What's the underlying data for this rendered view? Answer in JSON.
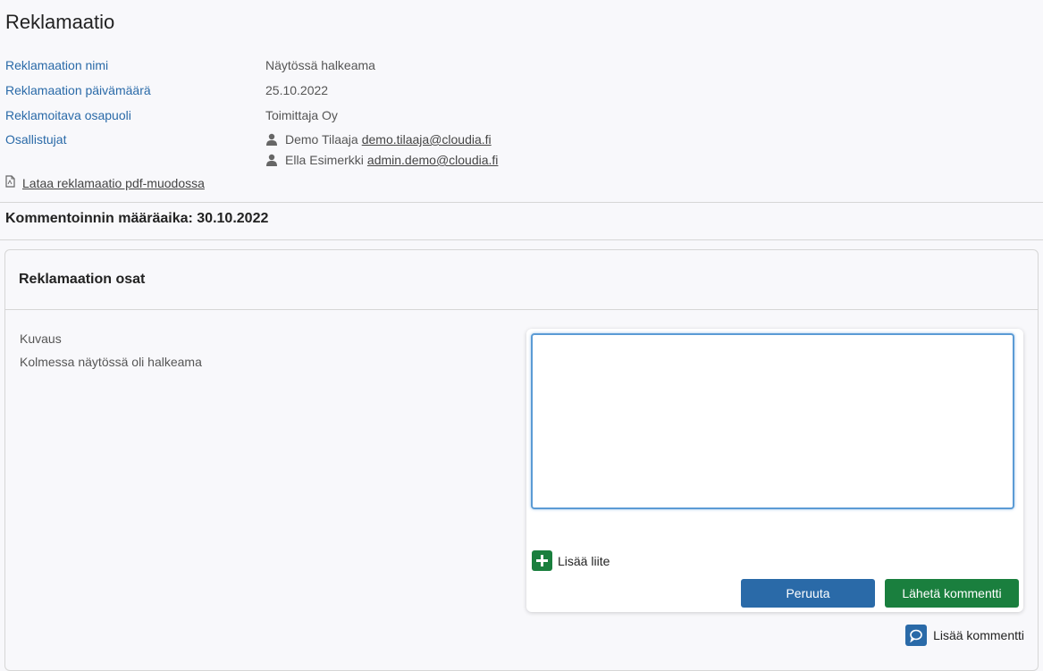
{
  "page": {
    "title": "Reklamaatio"
  },
  "details": [
    {
      "label": "Reklamaation nimi",
      "value": "Näytössä halkeama"
    },
    {
      "label": "Reklamaation päivämäärä",
      "value": "25.10.2022"
    },
    {
      "label": "Reklamoitava osapuoli",
      "value": "Toimittaja Oy"
    }
  ],
  "participants": {
    "label": "Osallistujat",
    "items": [
      {
        "name": "Demo Tilaaja",
        "email": "demo.tilaaja@cloudia.fi"
      },
      {
        "name": "Ella Esimerkki",
        "email": "admin.demo@cloudia.fi"
      }
    ]
  },
  "pdf_link": {
    "label": "Lataa reklamaatio pdf-muodossa",
    "icon": "pdf-file-icon"
  },
  "deadline": {
    "label": "Kommentoinnin määräaika:",
    "date": "30.10.2022"
  },
  "section": {
    "title": "Reklamaation osat",
    "description_label": "Kuvaus",
    "description_text": "Kolmessa näytössä oli halkeama"
  },
  "comment_form": {
    "value": "",
    "add_attachment_label": "Lisää liite",
    "cancel_label": "Peruuta",
    "send_label": "Lähetä kommentti"
  },
  "add_comment_label": "Lisää kommentti",
  "colors": {
    "link_blue": "#2a6aa8",
    "primary_green": "#1a7f3e",
    "focus_blue": "#5b9bd5"
  }
}
